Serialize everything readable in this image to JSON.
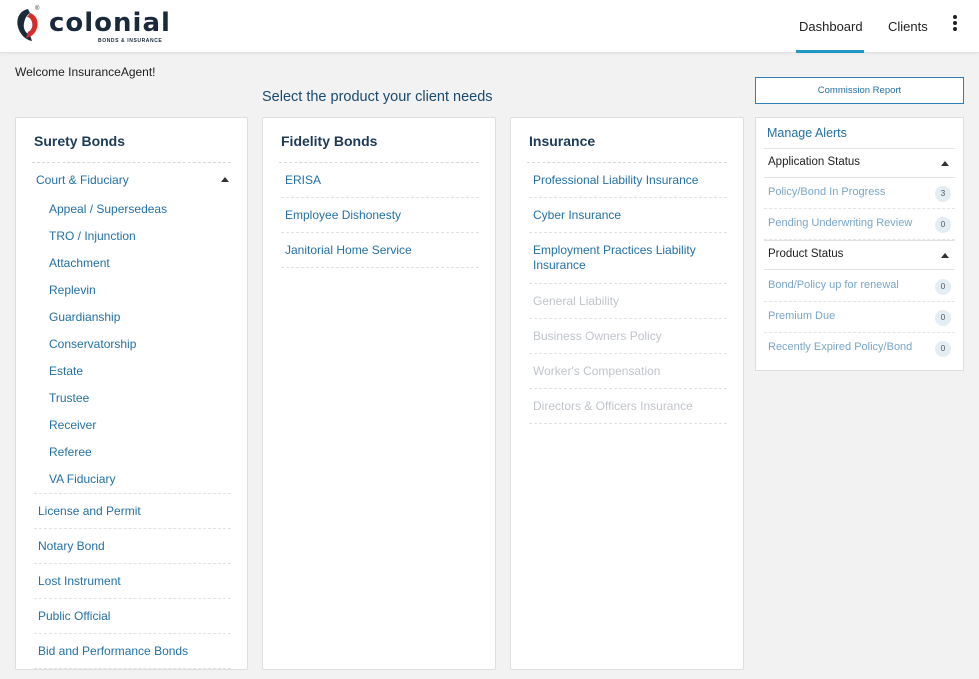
{
  "header": {
    "logo_word": "colonial",
    "logo_tag": "BONDS & INSURANCE",
    "logo_reg": "®",
    "nav": [
      {
        "label": "Dashboard"
      },
      {
        "label": "Clients"
      }
    ],
    "active_color": "#1f97c8"
  },
  "welcome": "Welcome InsuranceAgent!",
  "select_title": "Select the product your client needs",
  "surety": {
    "title": "Surety Bonds",
    "group": "Court & Fiduciary",
    "group_items": [
      "Appeal / Supersedeas",
      "TRO / Injunction",
      "Attachment",
      "Replevin",
      "Guardianship",
      "Conservatorship",
      "Estate",
      "Trustee",
      "Receiver",
      "Referee",
      "VA Fiduciary"
    ],
    "items": [
      "License and Permit",
      "Notary Bond",
      "Lost Instrument",
      "Public Official",
      "Bid and Performance Bonds"
    ]
  },
  "fidelity": {
    "title": "Fidelity Bonds",
    "items": [
      "ERISA",
      "Employee Dishonesty",
      "Janitorial Home Service"
    ]
  },
  "insurance": {
    "title": "Insurance",
    "items": [
      "Professional Liability Insurance",
      "Cyber Insurance",
      "Employment Practices Liability Insurance"
    ],
    "disabled_items": [
      "General Liability",
      "Business Owners Policy",
      "Worker's Compensation",
      "Directors & Officers Insurance"
    ]
  },
  "commission_button": "Commission Report",
  "alerts": {
    "title": "Manage Alerts",
    "application_status": {
      "label": "Application Status",
      "rows": [
        {
          "label": "Policy/Bond In Progress",
          "count": "3"
        },
        {
          "label": "Pending Underwriting Review",
          "count": "0"
        }
      ]
    },
    "product_status": {
      "label": "Product Status",
      "rows": [
        {
          "label": "Bond/Policy up for renewal",
          "count": "0"
        },
        {
          "label": "Premium Due",
          "count": "0"
        },
        {
          "label": "Recently Expired Policy/Bond",
          "count": "0"
        }
      ]
    }
  }
}
